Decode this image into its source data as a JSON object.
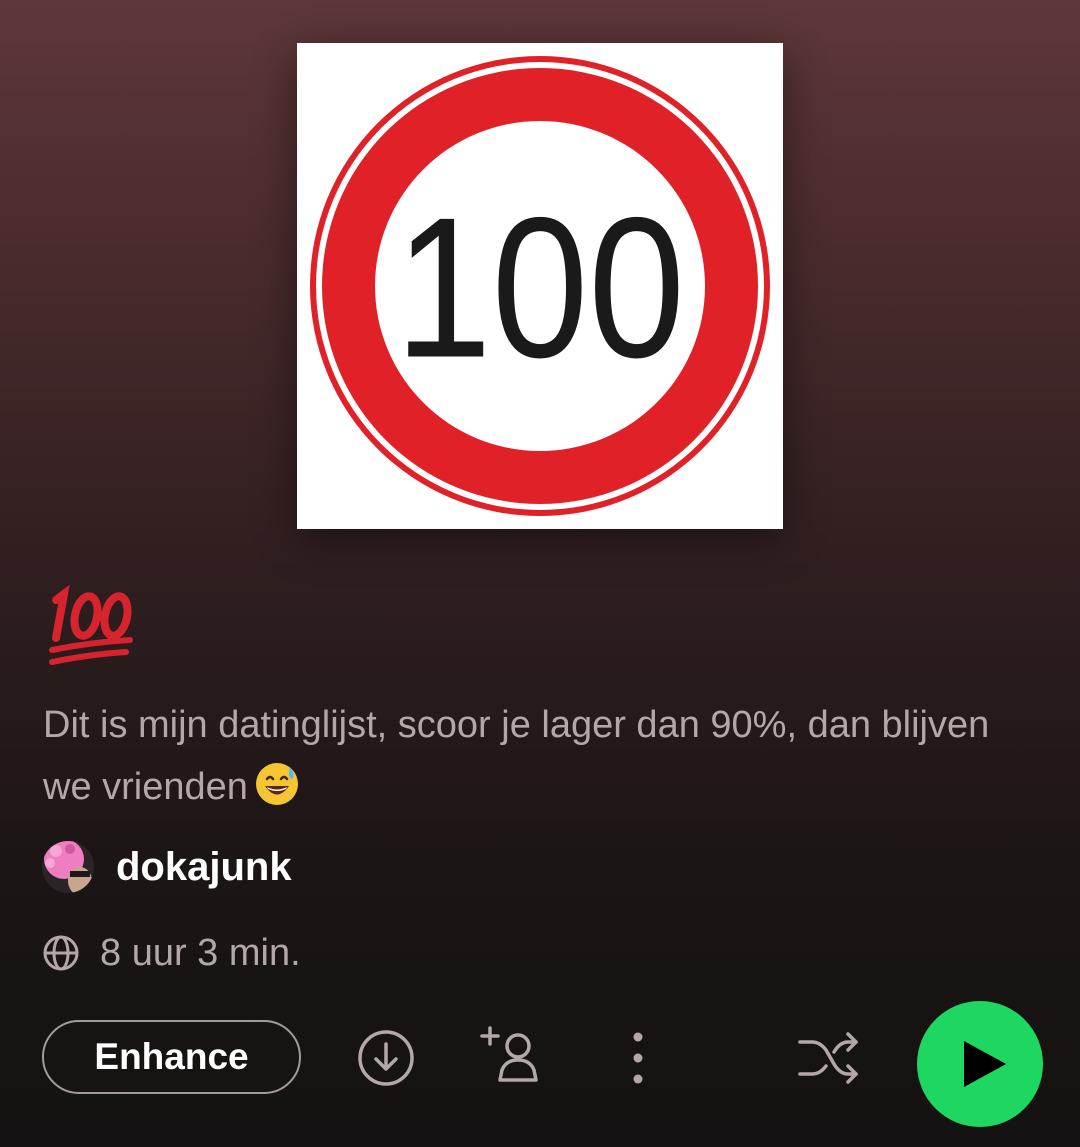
{
  "playlist": {
    "cover_text": "100",
    "title_emoji": "hundred-points-emoji",
    "description": "Dit is mijn datinglijst, scoor je lager dan 90%, dan blijven we vrienden",
    "description_emoji": "grinning-face-with-sweat-emoji",
    "owner": "dokajunk",
    "duration": "8 uur 3 min."
  },
  "actions": {
    "enhance_label": "Enhance",
    "download_icon": "download-icon",
    "add_collaborator_icon": "add-user-icon",
    "more_icon": "more-vertical-icon",
    "shuffle_icon": "shuffle-icon",
    "play_icon": "play-icon"
  },
  "colors": {
    "accent": "#1ed760",
    "sign_red": "#e02127",
    "background_top": "#5e3739",
    "background_bottom": "#141212",
    "secondary_text": "#b3a7a8"
  }
}
